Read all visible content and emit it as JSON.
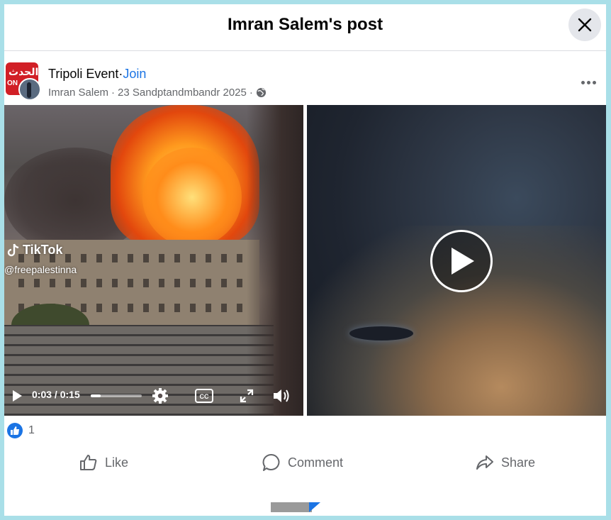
{
  "dialog": {
    "title": "Imran Salem's post"
  },
  "post": {
    "group_name": "Tripoli Event",
    "separator": "·",
    "join_label": "Join",
    "author": "Imran Salem",
    "date": "23 Sandptandmbandr 2025",
    "meta_dot": "·",
    "privacy_icon": "globe-icon",
    "group_logo_text": "الحدث",
    "group_logo_sub": "ON"
  },
  "video_left": {
    "watermark": "TikTok",
    "handle": "@freepalestinna",
    "current_time": "0:03",
    "time_separator": " / ",
    "duration": "0:15",
    "progress": 0.2,
    "cc_label": "CC"
  },
  "video_right": {
    "play_icon": "play-icon"
  },
  "reactions": {
    "count": "1"
  },
  "actions": {
    "like": "Like",
    "comment": "Comment",
    "share": "Share"
  },
  "colors": {
    "accent": "#1b74e4",
    "background_frame": "#a9dfe8",
    "muted_text": "#65676b"
  }
}
